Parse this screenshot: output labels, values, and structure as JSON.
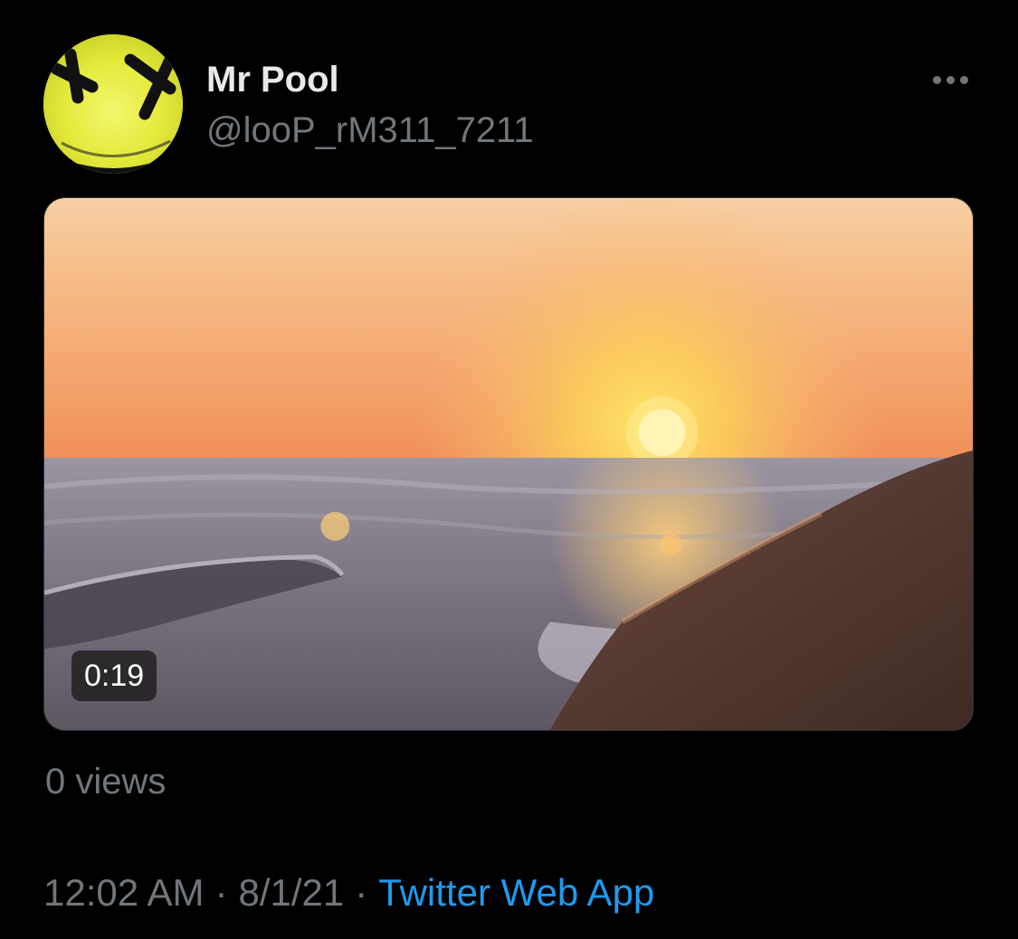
{
  "author": {
    "display_name": "Mr Pool",
    "handle": "@looP_rM311_7211",
    "avatar_icon": "deadpool-face-icon",
    "avatar_color": "#e6ec3e"
  },
  "more_icon": "more-horizontal-icon",
  "media": {
    "kind": "video",
    "duration": "0:19"
  },
  "views": "0 views",
  "meta": {
    "time": "12:02 AM",
    "separator": "·",
    "date": "8/1/21",
    "source": "Twitter Web App"
  },
  "colors": {
    "background": "#000000",
    "secondary_text": "#71767b",
    "link": "#1d9bf0",
    "primary_text": "#e7e9ea"
  }
}
